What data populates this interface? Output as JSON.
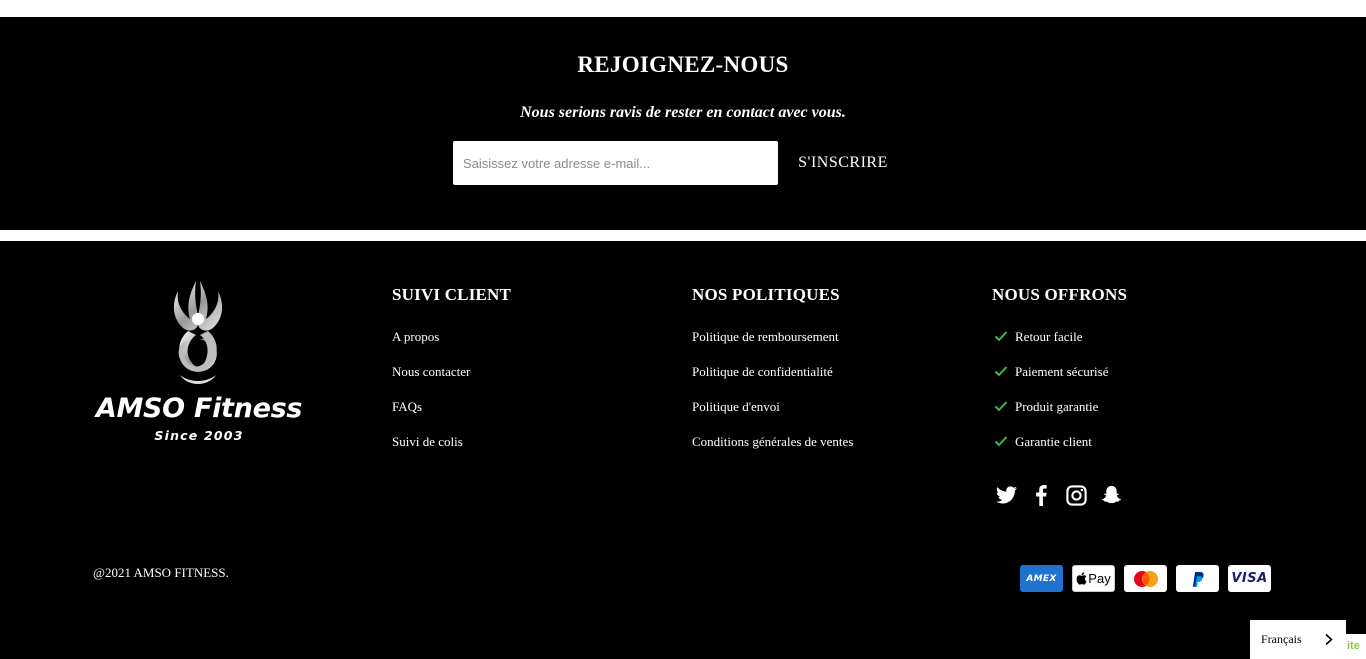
{
  "newsletter": {
    "title": "REJOIGNEZ-NOUS",
    "subtitle": "Nous serions ravis de rester en contact avec vous.",
    "email_placeholder": "Saisissez votre adresse e-mail...",
    "email_value": "",
    "submit_label": "S'INSCRIRE"
  },
  "logo": {
    "name": "AMSO Fitness",
    "tagline": "Since 2003"
  },
  "columns": [
    {
      "title": "SUIVI CLIENT",
      "items": [
        "A propos",
        "Nous contacter",
        "FAQs",
        "Suivi de colis"
      ]
    },
    {
      "title": "NOS POLITIQUES",
      "items": [
        "Politique de remboursement",
        "Politique de confidentialité",
        "Politique d'envoi",
        "Conditions générales de ventes"
      ]
    },
    {
      "title": "NOUS OFFRONS",
      "items": [
        "Retour facile",
        "Paiement sécurisé",
        "Produit garantie",
        "Garantie client"
      ]
    }
  ],
  "social_icons": [
    "twitter-icon",
    "facebook-icon",
    "instagram-icon",
    "snapchat-icon"
  ],
  "copyright": "@2021 AMSO FITNESS.",
  "payment_methods": {
    "amex": "AMEX",
    "applepay": "Pay",
    "mastercard": "",
    "paypal": "",
    "visa": "VISA"
  },
  "language": {
    "current": "Français"
  },
  "badge_partial": "ite",
  "colors": {
    "background": "#000000",
    "check": "#3fb950",
    "amex": "#1f72cd",
    "visa": "#1a1f71",
    "paypal_dark": "#003087",
    "paypal_light": "#009cde",
    "mastercard_red": "#eb001b",
    "mastercard_yellow": "#f79e1b"
  }
}
